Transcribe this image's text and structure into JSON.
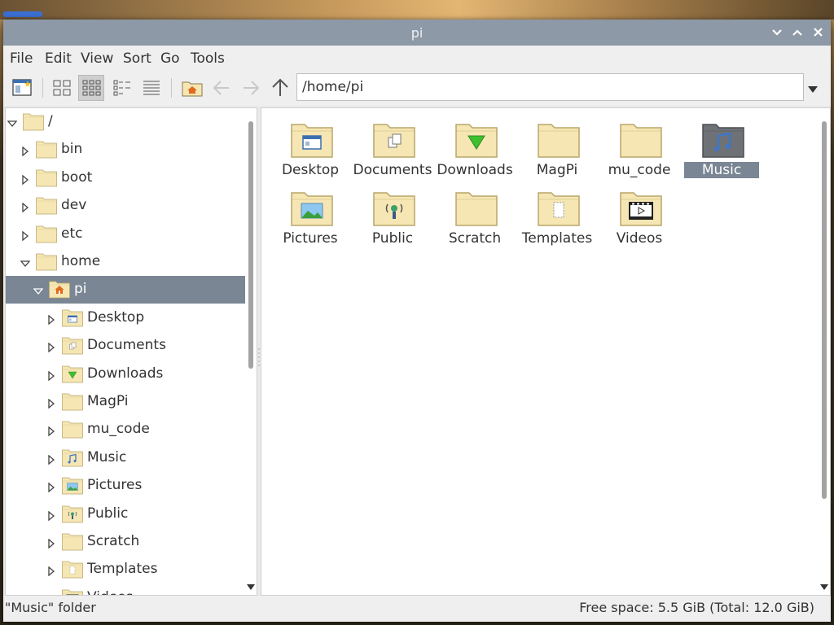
{
  "window": {
    "title": "pi"
  },
  "menu": [
    "File",
    "Edit",
    "View",
    "Sort",
    "Go",
    "Tools"
  ],
  "path": {
    "value": "/home/pi"
  },
  "tree": [
    {
      "label": "/",
      "depth": 0,
      "expanded": true,
      "icon": "folder-icon"
    },
    {
      "label": "bin",
      "depth": 1,
      "expanded": false,
      "icon": "folder-icon"
    },
    {
      "label": "boot",
      "depth": 1,
      "expanded": false,
      "icon": "folder-icon"
    },
    {
      "label": "dev",
      "depth": 1,
      "expanded": false,
      "icon": "folder-icon"
    },
    {
      "label": "etc",
      "depth": 1,
      "expanded": false,
      "icon": "folder-icon"
    },
    {
      "label": "home",
      "depth": 1,
      "expanded": true,
      "icon": "folder-icon"
    },
    {
      "label": "pi",
      "depth": 2,
      "expanded": true,
      "icon": "home-folder-icon",
      "selected": true
    },
    {
      "label": "Desktop",
      "depth": 3,
      "expanded": false,
      "icon": "desktop-folder-icon"
    },
    {
      "label": "Documents",
      "depth": 3,
      "expanded": false,
      "icon": "documents-folder-icon"
    },
    {
      "label": "Downloads",
      "depth": 3,
      "expanded": false,
      "icon": "downloads-folder-icon"
    },
    {
      "label": "MagPi",
      "depth": 3,
      "expanded": false,
      "icon": "folder-icon"
    },
    {
      "label": "mu_code",
      "depth": 3,
      "expanded": false,
      "icon": "folder-icon"
    },
    {
      "label": "Music",
      "depth": 3,
      "expanded": false,
      "icon": "music-folder-icon"
    },
    {
      "label": "Pictures",
      "depth": 3,
      "expanded": false,
      "icon": "pictures-folder-icon"
    },
    {
      "label": "Public",
      "depth": 3,
      "expanded": false,
      "icon": "public-folder-icon"
    },
    {
      "label": "Scratch",
      "depth": 3,
      "expanded": false,
      "icon": "folder-icon"
    },
    {
      "label": "Templates",
      "depth": 3,
      "expanded": false,
      "icon": "templates-folder-icon"
    },
    {
      "label": "Videos",
      "depth": 3,
      "expanded": false,
      "icon": "videos-folder-icon"
    }
  ],
  "files": [
    {
      "label": "Desktop",
      "icon": "desktop-folder-icon"
    },
    {
      "label": "Documents",
      "icon": "documents-folder-icon"
    },
    {
      "label": "Downloads",
      "icon": "downloads-folder-icon"
    },
    {
      "label": "MagPi",
      "icon": "folder-icon"
    },
    {
      "label": "mu_code",
      "icon": "folder-icon"
    },
    {
      "label": "Music",
      "icon": "music-folder-icon",
      "selected": true
    },
    {
      "label": "Pictures",
      "icon": "pictures-folder-icon"
    },
    {
      "label": "Public",
      "icon": "public-folder-icon"
    },
    {
      "label": "Scratch",
      "icon": "folder-icon"
    },
    {
      "label": "Templates",
      "icon": "templates-folder-icon"
    },
    {
      "label": "Videos",
      "icon": "videos-folder-icon"
    }
  ],
  "status": {
    "left": "\"Music\" folder",
    "right": "Free space: 5.5 GiB (Total: 12.0 GiB)"
  },
  "colors": {
    "titlebar": "#8d99a6",
    "selection": "#7a8694",
    "folder": "#f5e6b3"
  }
}
